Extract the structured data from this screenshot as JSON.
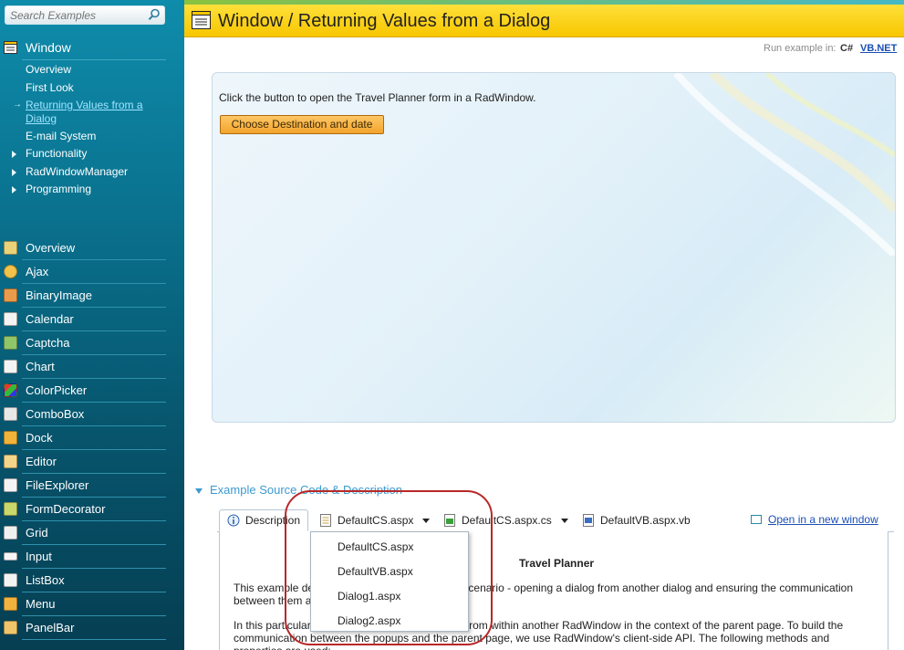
{
  "sidebar": {
    "search_placeholder": "Search Examples",
    "section_title": "Window",
    "sub_items": [
      "Overview",
      "First Look",
      "Returning Values from a Dialog",
      "E-mail System"
    ],
    "expand_items": [
      "Functionality",
      "RadWindowManager",
      "Programming"
    ],
    "controls": [
      "Overview",
      "Ajax",
      "BinaryImage",
      "Calendar",
      "Captcha",
      "Chart",
      "ColorPicker",
      "ComboBox",
      "Dock",
      "Editor",
      "FileExplorer",
      "FormDecorator",
      "Grid",
      "Input",
      "ListBox",
      "Menu",
      "PanelBar"
    ]
  },
  "header": {
    "title": "Window / Returning Values from a Dialog",
    "run_in": "Run example in:",
    "cs": "C#",
    "vb": "VB.NET"
  },
  "demo": {
    "instruction": "Click the button to open the Travel Planner form in a RadWindow.",
    "button": "Choose Destination and date"
  },
  "source": {
    "heading": "Example Source Code & Description",
    "tabs": [
      "Description",
      "DefaultCS.aspx",
      "DefaultCS.aspx.cs",
      "DefaultVB.aspx.vb"
    ],
    "open_link": "Open in a new window",
    "content_title": "Travel Planner",
    "para1": "This example de                                              d scenario - opening a dialog from another dialog and ensuring the communication between them a",
    "para2": "In this particular                                        pened from within another RadWindow in the context of the parent page. To build the communication between the popups and the parent page, we use RadWindow's client-side API. The following methods and properties are used:",
    "dropdown_items": [
      "DefaultCS.aspx",
      "DefaultVB.aspx",
      "Dialog1.aspx",
      "Dialog2.aspx"
    ]
  },
  "colors": {
    "header_yellow": "#f7c600",
    "sidebar_teal": "#0a7491",
    "link_blue": "#1b4fb3",
    "annotation_red": "#b82828"
  },
  "icons": {
    "search": "search-icon",
    "window": "window-icon",
    "info": "info-icon"
  }
}
